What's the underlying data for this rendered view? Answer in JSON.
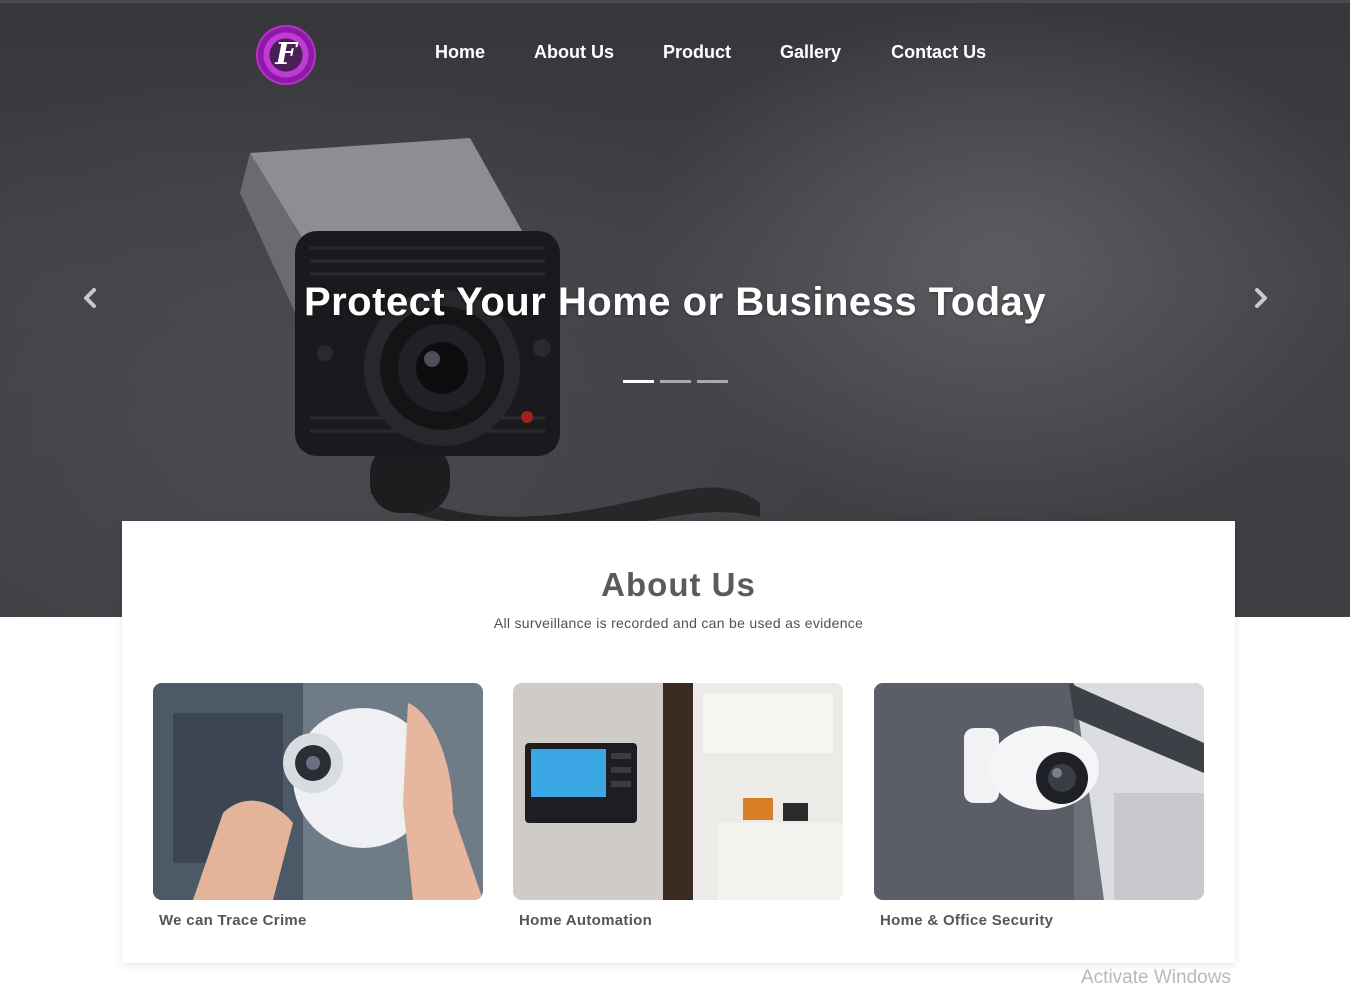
{
  "brand": {
    "logo_mark": "F",
    "accent": "#c13ad6"
  },
  "nav": {
    "items": [
      {
        "label": "Home"
      },
      {
        "label": "About Us"
      },
      {
        "label": "Product"
      },
      {
        "label": "Gallery"
      },
      {
        "label": "Contact Us"
      }
    ]
  },
  "hero": {
    "title": "Protect Your Home or Business Today",
    "prev_icon": "chevron-left-icon",
    "next_icon": "chevron-right-icon",
    "slides_count": 3,
    "active_slide": 1
  },
  "about": {
    "title": "About Us",
    "subtitle": "All surveillance is recorded and can be used as evidence",
    "features": [
      {
        "label": "We can Trace Crime"
      },
      {
        "label": "Home Automation"
      },
      {
        "label": "Home & Office Security"
      }
    ]
  },
  "watermark": "Activate Windows"
}
